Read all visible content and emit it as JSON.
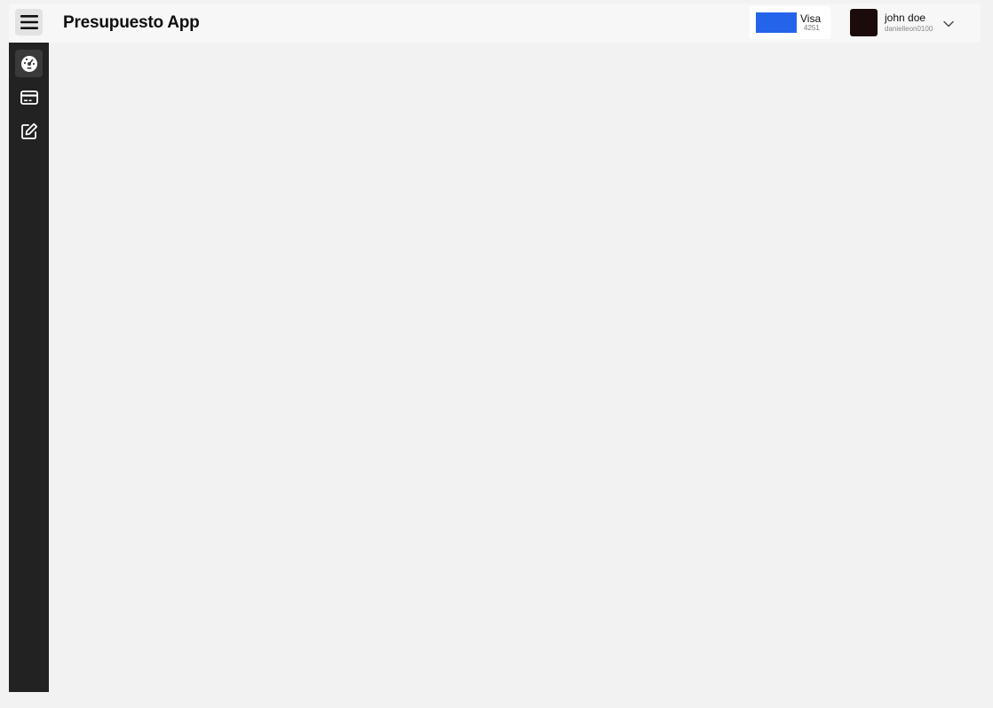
{
  "header": {
    "app_title": "Presupuesto App",
    "menu_icon": "hamburger-menu-icon"
  },
  "card": {
    "brand": "Visa",
    "last4": "4251",
    "color": "#2563eb"
  },
  "user": {
    "name": "john doe",
    "handle": "danielleon0100",
    "avatar_color": "#1c0b0b",
    "dropdown_icon": "chevron-down-icon"
  },
  "sidebar": {
    "items": [
      {
        "icon": "dashboard-gauge-icon",
        "active": true
      },
      {
        "icon": "credit-card-icon",
        "active": false
      },
      {
        "icon": "edit-note-icon",
        "active": false
      }
    ]
  },
  "colors": {
    "sidebar_bg": "#222222",
    "page_bg": "#f2f2f2",
    "topbar_bg": "#f7f7f7"
  }
}
